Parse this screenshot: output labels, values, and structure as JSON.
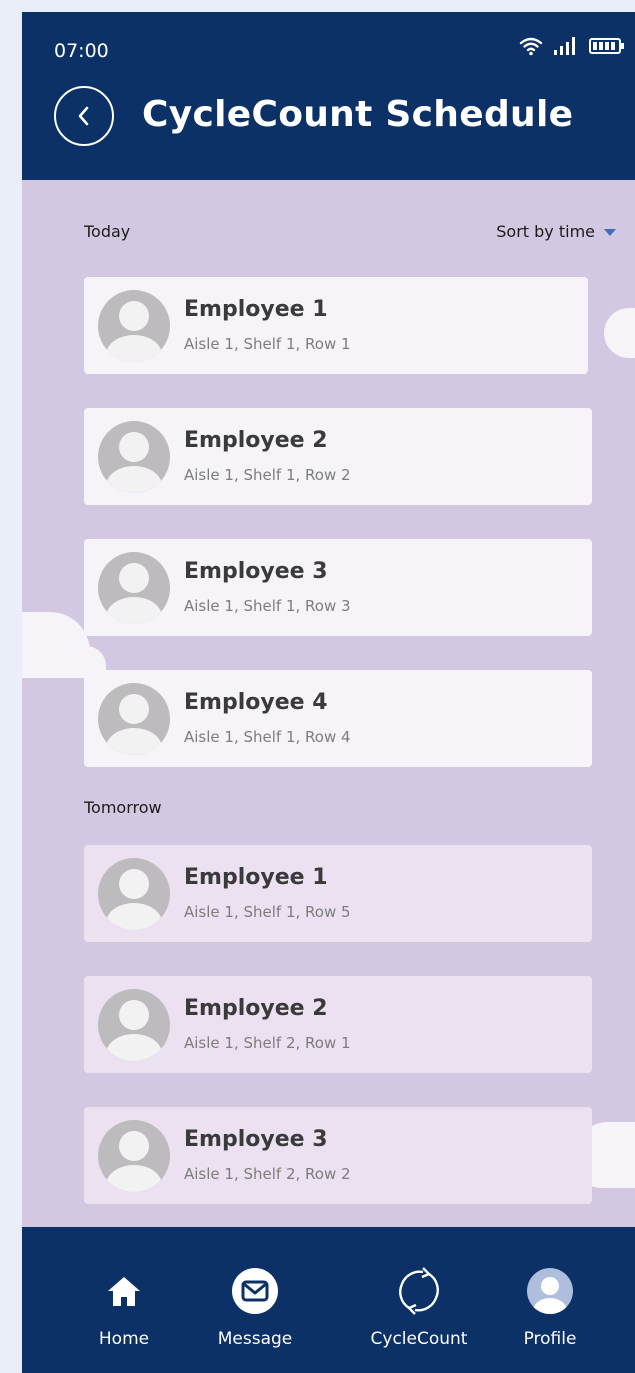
{
  "status_bar": {
    "time": "07:00"
  },
  "header": {
    "title": "CycleCount Schedule"
  },
  "sections": {
    "today_label": "Today",
    "tomorrow_label": "Tomorrow",
    "sort_label": "Sort by time"
  },
  "today": [
    {
      "name": "Employee 1",
      "location": "Aisle 1, Shelf 1, Row 1"
    },
    {
      "name": "Employee 2",
      "location": "Aisle 1, Shelf 1, Row 2"
    },
    {
      "name": "Employee 3",
      "location": "Aisle 1, Shelf 1, Row 3"
    },
    {
      "name": "Employee 4",
      "location": "Aisle 1, Shelf 1, Row 4"
    }
  ],
  "tomorrow": [
    {
      "name": "Employee 1",
      "location": "Aisle 1, Shelf 1, Row 5"
    },
    {
      "name": "Employee 2",
      "location": "Aisle 1, Shelf 2, Row 1"
    },
    {
      "name": "Employee 3",
      "location": "Aisle 1, Shelf 2, Row 2"
    }
  ],
  "nav": {
    "home": "Home",
    "message": "Message",
    "cyclecount": "CycleCount",
    "profile": "Profile"
  },
  "colors": {
    "primary": "#0c3166",
    "background": "#d2c8e2",
    "card_today": "#f6f3f9",
    "card_tomorrow": "#ebe1f0",
    "sort_arrow": "#3b6fc4"
  }
}
